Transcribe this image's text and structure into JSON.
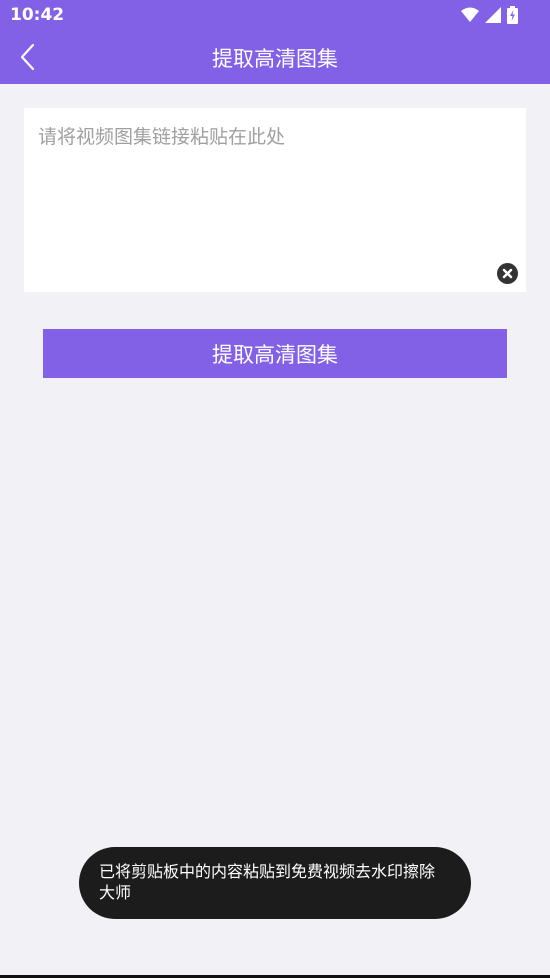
{
  "status_bar": {
    "time": "10:42",
    "icons": [
      "wifi-icon",
      "cellular-signal-icon",
      "battery-charging-icon"
    ]
  },
  "app_bar": {
    "title": "提取高清图集",
    "back_icon": "chevron-left-icon"
  },
  "input": {
    "value": "",
    "placeholder": "请将视频图集链接粘贴在此处",
    "clear_icon": "close-circle-icon"
  },
  "extract_button": {
    "label": "提取高清图集"
  },
  "toast": {
    "message": "已将剪贴板中的内容粘贴到免费视频去水印擦除大师"
  },
  "colors": {
    "primary": "#8361e6",
    "background": "#f1f1f6",
    "toast_bg": "#1c1c1c"
  }
}
